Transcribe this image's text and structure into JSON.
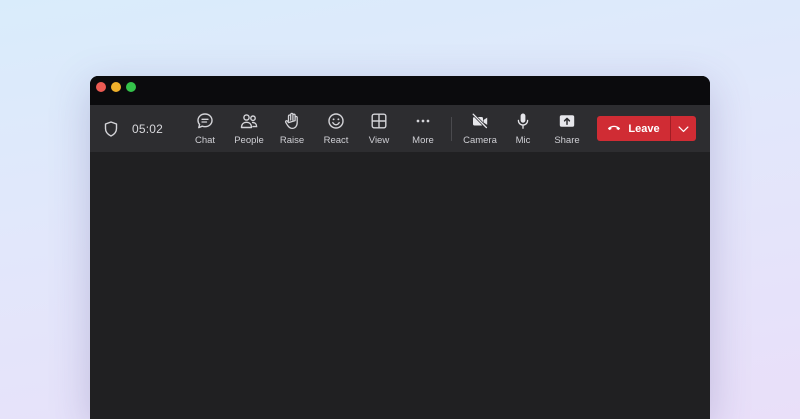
{
  "call": {
    "timer": "05:02"
  },
  "toolbar": {
    "items": [
      {
        "label": "Chat",
        "icon": "chat-bubble-icon"
      },
      {
        "label": "People",
        "icon": "people-icon"
      },
      {
        "label": "Raise",
        "icon": "raise-hand-icon"
      },
      {
        "label": "React",
        "icon": "smiley-icon"
      },
      {
        "label": "View",
        "icon": "grid-view-icon"
      },
      {
        "label": "More",
        "icon": "ellipsis-icon"
      },
      {
        "label": "Camera",
        "icon": "camera-off-icon"
      },
      {
        "label": "Mic",
        "icon": "microphone-icon"
      },
      {
        "label": "Share",
        "icon": "share-screen-icon"
      }
    ],
    "leave_label": "Leave"
  },
  "colors": {
    "leave_button": "#d02c34",
    "toolbar_bg": "#2d2d30",
    "stage_bg": "#202022"
  }
}
